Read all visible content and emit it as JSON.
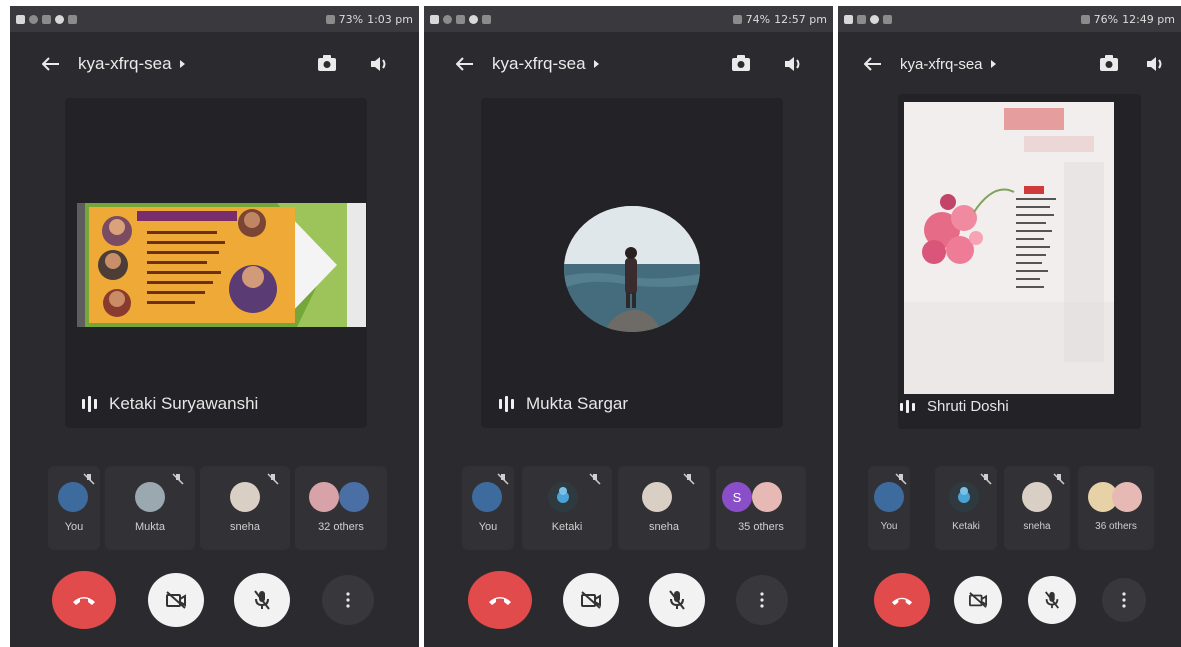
{
  "colors": {
    "background": "#2b2b2f",
    "hangup": "#e24b4b",
    "control": "#f2f2f2"
  },
  "screens": [
    {
      "status": {
        "battery": "73%",
        "time": "1:03 pm"
      },
      "meeting_code": "kya-xfrq-sea",
      "main_speaker": "Ketaki Suryawanshi",
      "participants": [
        "You",
        "Mukta",
        "sneha",
        "32 others"
      ]
    },
    {
      "status": {
        "battery": "74%",
        "time": "12:57 pm"
      },
      "meeting_code": "kya-xfrq-sea",
      "main_speaker": "Mukta Sargar",
      "participants": [
        "You",
        "Ketaki",
        "sneha",
        "35 others"
      ],
      "others_initial": "S"
    },
    {
      "status": {
        "battery": "76%",
        "time": "12:49 pm"
      },
      "meeting_code": "kya-xfrq-sea",
      "main_speaker": "Shruti Doshi",
      "participants": [
        "You",
        "Ketaki",
        "sneha",
        "36 others"
      ]
    }
  ],
  "icons": {
    "back": "arrow-left-icon",
    "switch_camera": "switch-camera-icon",
    "speaker": "volume-icon",
    "hangup": "phone-hangup-icon",
    "camera_off": "camera-off-icon",
    "mic_off": "mic-off-icon",
    "more": "more-vert-icon"
  }
}
